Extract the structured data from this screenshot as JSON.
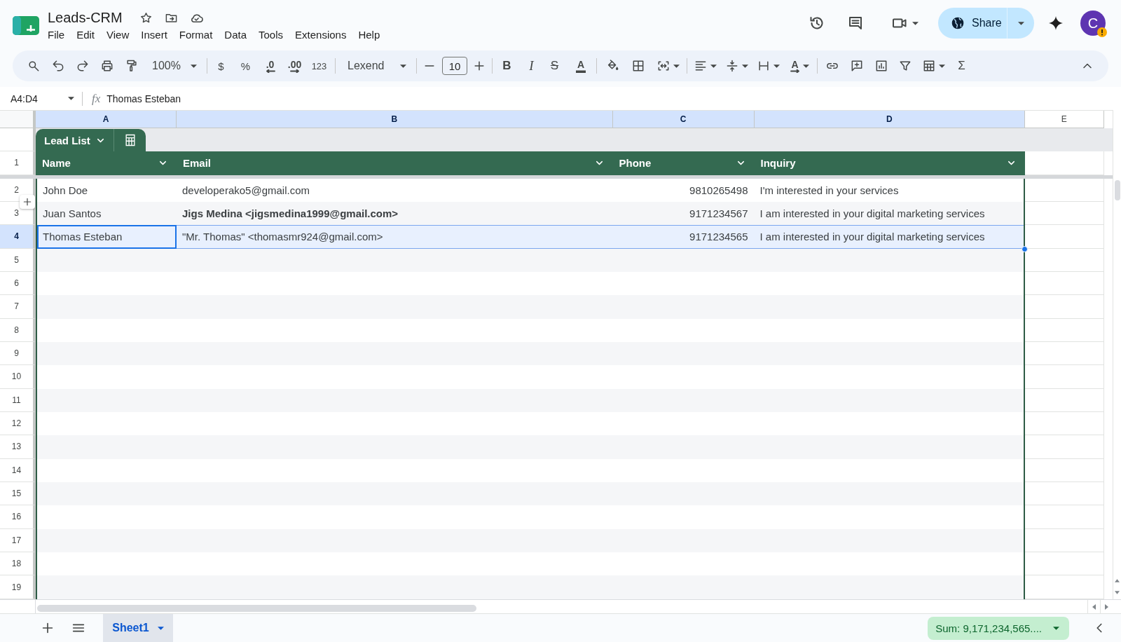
{
  "document": {
    "title": "Leads-CRM"
  },
  "menu": [
    "File",
    "Edit",
    "View",
    "Insert",
    "Format",
    "Data",
    "Tools",
    "Extensions",
    "Help"
  ],
  "share_button": {
    "label": "Share"
  },
  "account": {
    "initial": "C"
  },
  "toolbar": {
    "zoom": "100%",
    "currency": "$",
    "percent": "%",
    "decrease_decimal": ".0",
    "increase_decimal": ".00",
    "number_format": "123",
    "font": "Lexend",
    "font_size": "10",
    "bold": "B",
    "italic": "I",
    "strikethrough": "S",
    "text_color": "A",
    "text_rotation": "A",
    "functions": "Σ"
  },
  "formula_bar": {
    "cell_range": "A4:D4",
    "fx": "fx",
    "value": "Thomas Esteban"
  },
  "column_headers": [
    {
      "label": "A",
      "selected": true
    },
    {
      "label": "B",
      "selected": true
    },
    {
      "label": "C",
      "selected": true
    },
    {
      "label": "D",
      "selected": true
    },
    {
      "label": "E",
      "selected": false
    }
  ],
  "row_headers": [
    {
      "label": "1",
      "selected": false
    },
    {
      "label": "2",
      "selected": false
    },
    {
      "label": "3",
      "selected": false
    },
    {
      "label": "4",
      "selected": true
    },
    {
      "label": "5",
      "selected": false
    },
    {
      "label": "6",
      "selected": false
    },
    {
      "label": "7",
      "selected": false
    },
    {
      "label": "8",
      "selected": false
    },
    {
      "label": "9",
      "selected": false
    },
    {
      "label": "10",
      "selected": false
    },
    {
      "label": "11",
      "selected": false
    },
    {
      "label": "12",
      "selected": false
    },
    {
      "label": "13",
      "selected": false
    },
    {
      "label": "14",
      "selected": false
    },
    {
      "label": "15",
      "selected": false
    },
    {
      "label": "16",
      "selected": false
    },
    {
      "label": "17",
      "selected": false
    },
    {
      "label": "18",
      "selected": false
    },
    {
      "label": "19",
      "selected": false
    }
  ],
  "table": {
    "name": "Lead List",
    "columns": [
      {
        "label": "Name",
        "kind": "text"
      },
      {
        "label": "Email",
        "kind": "text"
      },
      {
        "label": "Phone",
        "kind": "number"
      },
      {
        "label": "Inquiry",
        "kind": "text"
      }
    ],
    "rows": [
      {
        "selected": false,
        "cells": [
          {
            "text": "John Doe",
            "bold": false,
            "active": false
          },
          {
            "text": "developerako5@gmail.com",
            "bold": false,
            "active": false
          },
          {
            "text": "9810265498",
            "bold": false,
            "active": false
          },
          {
            "text": "I'm interested in your services",
            "bold": false,
            "active": false
          }
        ]
      },
      {
        "selected": false,
        "cells": [
          {
            "text": "Juan Santos",
            "bold": false,
            "active": false
          },
          {
            "text": "Jigs Medina <jigsmedina1999@gmail.com>",
            "bold": true,
            "active": false
          },
          {
            "text": "9171234567",
            "bold": false,
            "active": false
          },
          {
            "text": "I am interested in your digital marketing services",
            "bold": false,
            "active": false
          }
        ]
      },
      {
        "selected": true,
        "cells": [
          {
            "text": "Thomas Esteban",
            "bold": false,
            "active": true
          },
          {
            "text": "\"Mr. Thomas\" <thomasmr924@gmail.com>",
            "bold": false,
            "active": false
          },
          {
            "text": "9171234565",
            "bold": false,
            "active": false
          },
          {
            "text": "I am interested in your digital marketing services",
            "bold": false,
            "active": false
          }
        ]
      }
    ]
  },
  "sheets": [
    {
      "label": "Sheet1",
      "selected": true
    }
  ],
  "status_bar": {
    "sum": "Sum: 9,171,234,565...."
  }
}
